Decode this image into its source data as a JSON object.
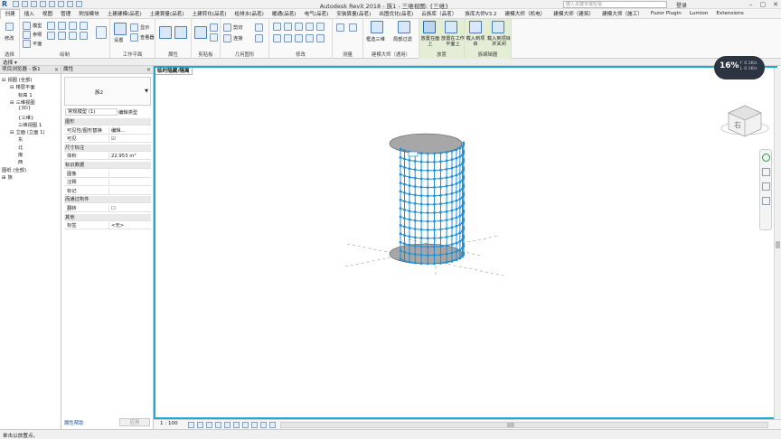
{
  "app": {
    "title": "Autodesk Revit 2018 -   族1 - 三维视图: {三维}",
    "search_placeholder": "键入关键字或短语",
    "login_label": "登录",
    "logo_letter": "R"
  },
  "tabs": [
    "创建",
    "插入",
    "视图",
    "管理",
    "附加模块",
    "土建建模(品茗)",
    "土建算量(品茗)",
    "土建转化(品茗)",
    "给排水(品茗)",
    "暖通(品茗)",
    "电气(品茗)",
    "安装算量(品茗)",
    "出图优化(品茗)",
    "云族库（品茗）",
    "族库大师V3.2",
    "建模大师（机电）",
    "建模大师（建筑）",
    "建模大师（施工）",
    "Fuzor Plugin",
    "Lumion",
    "Extensions"
  ],
  "active_tab_index": 0,
  "ribbon": {
    "groups": [
      {
        "label": "选择",
        "buttons": [
          "修改"
        ]
      },
      {
        "label": "绘制",
        "buttons": [
          "模型",
          "参照",
          "平面"
        ]
      },
      {
        "label": "工作平面",
        "buttons": [
          "设置",
          "显示",
          "查看器"
        ]
      },
      {
        "label": "属性",
        "buttons": []
      },
      {
        "label": "剪贴板",
        "buttons": []
      },
      {
        "label": "几何图形",
        "buttons": [
          "剪切",
          "连接"
        ]
      },
      {
        "label": "修改",
        "buttons": []
      },
      {
        "label": "测量",
        "buttons": []
      },
      {
        "label": "建模大师（通用）",
        "buttons": [
          "框选三维",
          "局部过滤"
        ]
      },
      {
        "label": "放置",
        "buttons": [
          "放置在面上",
          "放置在工作平面上"
        ]
      },
      {
        "label": "族编辑器",
        "buttons": [
          "载入到项目",
          "载入到项目并关闭"
        ]
      }
    ]
  },
  "context_bar": {
    "select_label": "选择 ▾"
  },
  "project_browser": {
    "title": "项目浏览器 - 族1",
    "items": [
      {
        "label": "视图 (全部)",
        "indent": 0,
        "toggle": "⊟"
      },
      {
        "label": "楼层平面",
        "indent": 1,
        "toggle": "⊟"
      },
      {
        "label": "标高 1",
        "indent": 2,
        "toggle": ""
      },
      {
        "label": "三维视图",
        "indent": 1,
        "toggle": "⊟"
      },
      {
        "label": "{3D}",
        "indent": 2,
        "toggle": ""
      },
      {
        "label": "{三维}",
        "indent": 2,
        "toggle": ""
      },
      {
        "label": "三维视图 1",
        "indent": 2,
        "toggle": ""
      },
      {
        "label": "立面 (立面 1)",
        "indent": 1,
        "toggle": "⊟"
      },
      {
        "label": "东",
        "indent": 2,
        "toggle": ""
      },
      {
        "label": "北",
        "indent": 2,
        "toggle": ""
      },
      {
        "label": "南",
        "indent": 2,
        "toggle": ""
      },
      {
        "label": "西",
        "indent": 2,
        "toggle": ""
      },
      {
        "label": "图纸 (全部)",
        "indent": 0,
        "toggle": ""
      },
      {
        "label": "族",
        "indent": 0,
        "toggle": "⊞"
      }
    ]
  },
  "properties": {
    "title": "属性",
    "family_name": "族2",
    "type_selector": "常规模型 (1)",
    "edit_type_label": "编辑类型",
    "rows": [
      {
        "key": "图形",
        "value": "",
        "category": true
      },
      {
        "key": "可见性/图形替换",
        "value": "编辑...",
        "category": false
      },
      {
        "key": "可见",
        "value": "☑",
        "category": false
      },
      {
        "key": "尺寸标注",
        "value": "",
        "category": true
      },
      {
        "key": "体积",
        "value": "22.953 m³",
        "category": false
      },
      {
        "key": "标识数据",
        "value": "",
        "category": true
      },
      {
        "key": "图像",
        "value": "",
        "category": false
      },
      {
        "key": "注释",
        "value": "",
        "category": false
      },
      {
        "key": "标记",
        "value": "",
        "category": false
      },
      {
        "key": "而通过构件",
        "value": "",
        "category": true
      },
      {
        "key": "翻转",
        "value": "☐",
        "category": false
      },
      {
        "key": "其他",
        "value": "",
        "category": true
      },
      {
        "key": "标签",
        "value": "<无>",
        "category": false
      }
    ],
    "help_label": "属性帮助",
    "apply_label": "应用"
  },
  "viewport": {
    "tab_label": "临时隐藏/隔离",
    "cube_face": "右"
  },
  "view_bar": {
    "scale": "1 : 100"
  },
  "status_bar": {
    "message": "单击以放置点。"
  },
  "badge": {
    "percent": "16%",
    "line1": "↑ 0.1K/s",
    "line2": "↓ 0.1K/s"
  },
  "colors": {
    "accent": "#1fa9d4",
    "mesh": "#1f8fd8",
    "disk": "#a7a7a7"
  }
}
